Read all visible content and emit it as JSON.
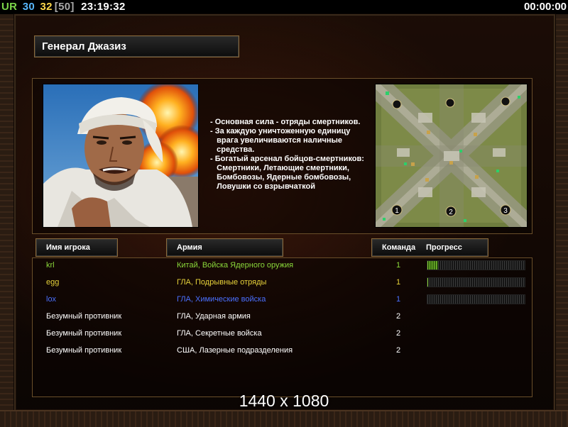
{
  "hud": {
    "ur": "UR",
    "fps": "30",
    "fps2": "32",
    "fps_limit": "[50]",
    "clock": "23:19:32",
    "timer": "00:00:00"
  },
  "colors": {
    "ur": "#7cd64a",
    "fps": "#58b8ff",
    "fps2": "#ffd84a",
    "fps_limit": "#a8a8a8",
    "player_green": "#8ad83a",
    "player_yellow": "#e6d23a",
    "player_blue": "#4a70ff",
    "neutral": "#ffffff"
  },
  "general": {
    "title": "Генерал Джазиз",
    "description": [
      "- Основная сила - отряды смертников.",
      "- За каждую уничтоженную единицу",
      "   врага увеличиваются наличные",
      "   средства.",
      "- Богатый арсенал бойцов-смертников:",
      "   Смертники, Летающие смертники,",
      "   Бомбовозы, Ядерные бомбовозы,",
      "   Ловушки со взрывчаткой"
    ]
  },
  "map": {
    "start_positions": [
      "1",
      "2",
      "3"
    ]
  },
  "table": {
    "headers": {
      "name": "Имя игрока",
      "army": "Армия",
      "team": "Команда",
      "progress": "Прогресс"
    },
    "rows": [
      {
        "name": "krl",
        "army": "Китай, Войска Ядерного оружия",
        "team": "1",
        "color": "#8ad83a",
        "progress": 0.11
      },
      {
        "name": "egg",
        "army": "ГЛА, Подрывные отряды",
        "team": "1",
        "color": "#e6d23a",
        "progress": 0.01
      },
      {
        "name": "lox",
        "army": "ГЛА, Химические войска",
        "team": "1",
        "color": "#4a70ff",
        "progress": 0.0
      },
      {
        "name": "Безумный противник",
        "army": "ГЛА, Ударная армия",
        "team": "2",
        "color": "#ffffff"
      },
      {
        "name": "Безумный противник",
        "army": "ГЛА, Секретные войска",
        "team": "2",
        "color": "#ffffff"
      },
      {
        "name": "Безумный противник",
        "army": "США, Лазерные подразделения",
        "team": "2",
        "color": "#ffffff"
      }
    ]
  },
  "resolution_label": "1440 x 1080"
}
